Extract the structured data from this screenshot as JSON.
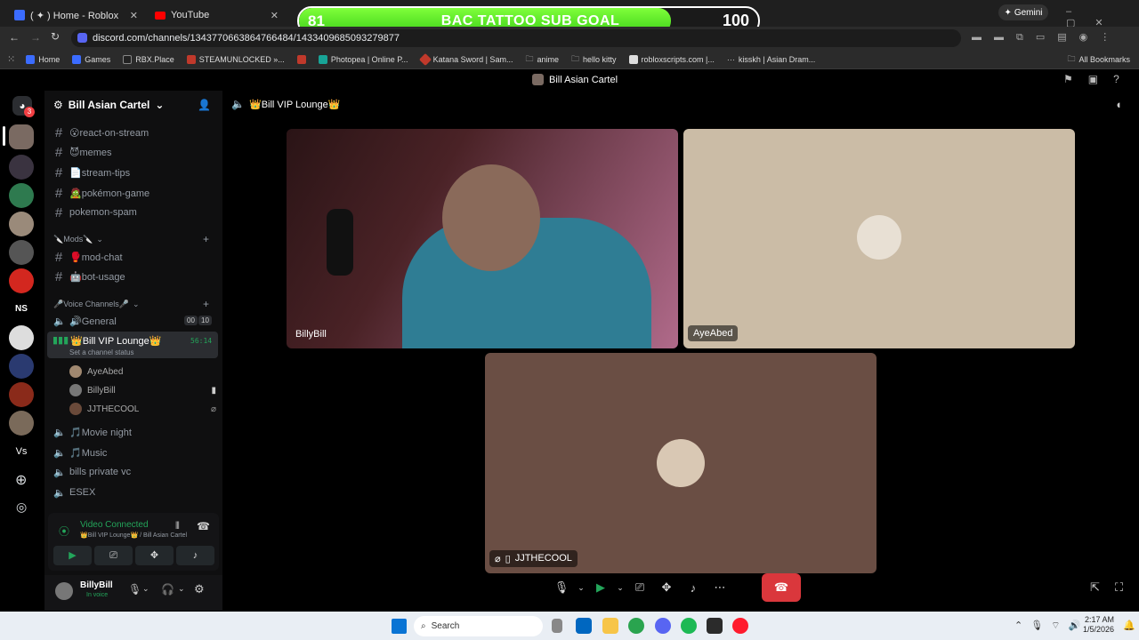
{
  "browser": {
    "tabs": [
      {
        "label": "( ✦ ) Home - Roblox"
      },
      {
        "label": "YouTube"
      }
    ],
    "url": "discord.com/channels/1343770663864766484/1433409685093279877",
    "gemini_label": "Gemini",
    "bookmarks": [
      "Home",
      "Games",
      "RBX.Place",
      "STEAMUNLOCKED »...",
      "Photopea | Online P...",
      "Katana Sword | Sam...",
      "anime",
      "hello kitty",
      "robloxscripts.com |...",
      "kisskh | Asian Dram..."
    ],
    "all_bookmarks": "All Bookmarks"
  },
  "goal": {
    "current": "81",
    "label": "BAC TATTOO SUB GOAL",
    "target": "100",
    "progress": 0.81
  },
  "discord": {
    "window_title": "Bill Asian Cartel",
    "server_name": "Bill Asian Cartel",
    "server_badge": "3",
    "channels": [
      {
        "name": "😮react-on-stream"
      },
      {
        "name": "😈memes"
      },
      {
        "name": "📄stream-tips"
      },
      {
        "name": "🧟pokémon-game"
      },
      {
        "name": "pokemon-spam"
      }
    ],
    "mods_category": "🔪Mods🔪",
    "mod_channels": [
      {
        "name": "🥊mod-chat"
      },
      {
        "name": "🤖bot-usage"
      }
    ],
    "voice_category": "🎤Voice Channels🎤",
    "general": {
      "name": "🔊General",
      "count_a": "00",
      "count_b": "10"
    },
    "vip": {
      "name": "👑Bill VIP Lounge👑",
      "timer": "56:14",
      "status_placeholder": "Set a channel status"
    },
    "members": [
      "AyeAbed",
      "BillyBill",
      "JJTHECOOL"
    ],
    "other_voice": [
      "🎵Movie night",
      "🎵Music",
      "bills private vc",
      "ESEX"
    ],
    "connection": {
      "status": "Video Connected",
      "location": "👑Bill VIP Lounge👑 / Bill Asian Cartel"
    },
    "user": {
      "name": "BillyBill",
      "status": "In voice"
    },
    "stage_channel": "👑Bill VIP Lounge👑",
    "participants": {
      "tile1": "BillyBill",
      "tile2": "AyeAbed",
      "tile3": "JJTHECOOL"
    }
  },
  "taskbar": {
    "search": "Search",
    "time": "2:17 AM",
    "date": "1/5/2026"
  }
}
